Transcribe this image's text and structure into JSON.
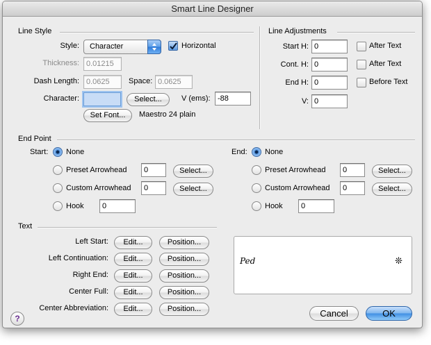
{
  "window": {
    "title": "Smart Line Designer"
  },
  "line_style": {
    "group_title": "Line Style",
    "style_label": "Style:",
    "style_value": "Character",
    "horizontal_label": "Horizontal",
    "horizontal_checked": true,
    "thickness_label": "Thickness:",
    "thickness_value": "0.01215",
    "dash_length_label": "Dash Length:",
    "dash_length_value": "0.0625",
    "space_label": "Space:",
    "space_value": "0.0625",
    "character_label": "Character:",
    "character_value": "",
    "select_button": "Select...",
    "v_ems_label": "V (ems):",
    "v_ems_value": "-88",
    "set_font_button": "Set Font...",
    "font_name": "Maestro 24 plain"
  },
  "line_adjustments": {
    "group_title": "Line Adjustments",
    "start_h_label": "Start H:",
    "start_h_value": "0",
    "cont_h_label": "Cont. H:",
    "cont_h_value": "0",
    "end_h_label": "End H:",
    "end_h_value": "0",
    "v_label": "V:",
    "v_value": "0",
    "after_text_1": "After Text",
    "after_text_2": "After Text",
    "before_text": "Before Text"
  },
  "end_point": {
    "group_title": "End Point",
    "start": {
      "label": "Start:",
      "none": "None",
      "preset": "Preset Arrowhead",
      "preset_value": "0",
      "custom": "Custom Arrowhead",
      "custom_value": "0",
      "hook": "Hook",
      "hook_value": "0",
      "select_1": "Select...",
      "select_2": "Select...",
      "selected": "none"
    },
    "end": {
      "label": "End:",
      "none": "None",
      "preset": "Preset Arrowhead",
      "preset_value": "0",
      "custom": "Custom Arrowhead",
      "custom_value": "0",
      "hook": "Hook",
      "hook_value": "0",
      "select_1": "Select...",
      "select_2": "Select...",
      "selected": "none"
    }
  },
  "text_section": {
    "group_title": "Text",
    "rows": [
      {
        "label": "Left Start:",
        "edit": "Edit...",
        "position": "Position..."
      },
      {
        "label": "Left Continuation:",
        "edit": "Edit...",
        "position": "Position..."
      },
      {
        "label": "Right End:",
        "edit": "Edit...",
        "position": "Position..."
      },
      {
        "label": "Center Full:",
        "edit": "Edit...",
        "position": "Position..."
      },
      {
        "label": "Center Abbreviation:",
        "edit": "Edit...",
        "position": "Position..."
      }
    ]
  },
  "preview": {
    "left_symbol": "Ped",
    "right_symbol": "❊"
  },
  "footer": {
    "cancel": "Cancel",
    "ok": "OK",
    "help": "?"
  },
  "colors": {
    "accent": "#3f8ee3",
    "focus_fill": "#c8dcf6",
    "window_bg": "#ececec"
  }
}
